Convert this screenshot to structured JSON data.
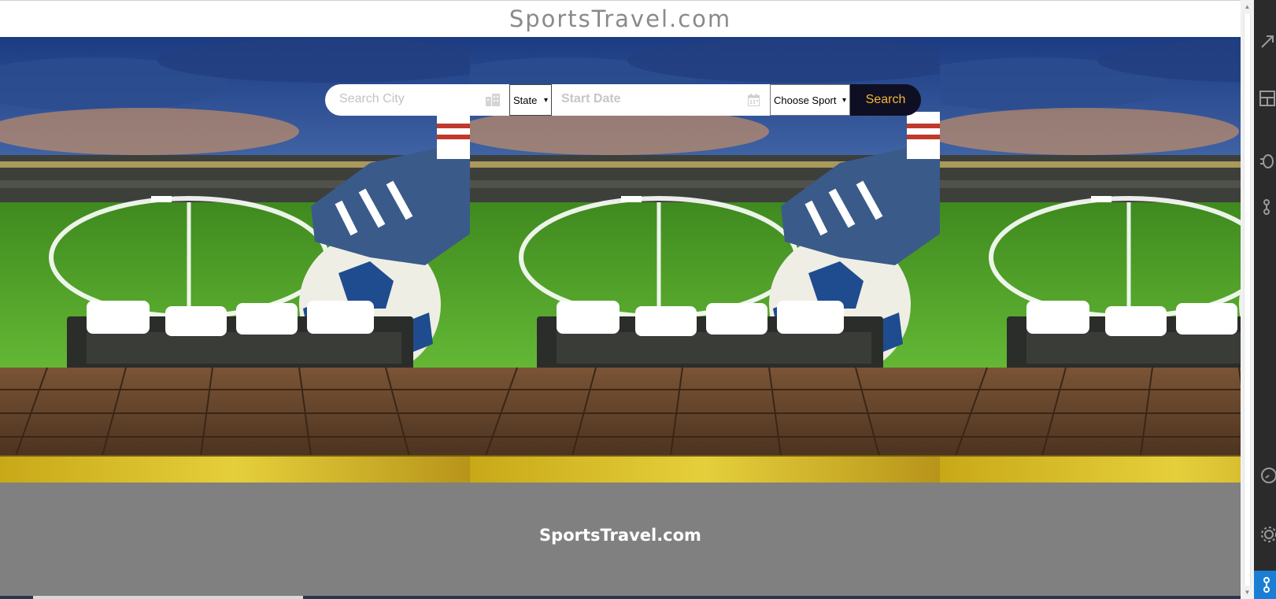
{
  "header": {
    "site_title": "SportsTravel.com"
  },
  "search": {
    "city_placeholder": "Search City",
    "state_label": "State",
    "date_placeholder": "Start Date",
    "sport_label": "Choose Sport",
    "search_button": "Search"
  },
  "footer": {
    "site_title": "SportsTravel.com"
  },
  "colors": {
    "search_button_bg": "#0f0f24",
    "search_button_text": "#f2b733",
    "footer_bg": "#808080",
    "header_title": "#8a8a8a"
  }
}
